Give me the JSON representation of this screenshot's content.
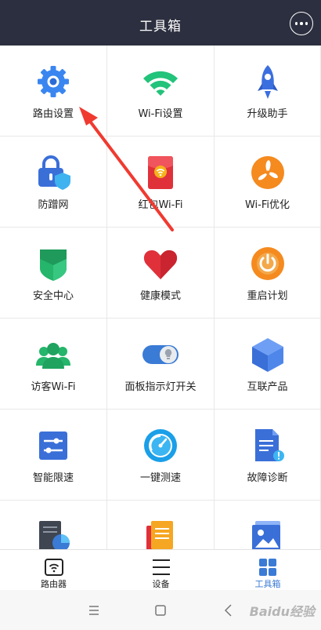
{
  "header": {
    "title": "工具箱"
  },
  "tools": [
    {
      "label": "路由设置",
      "icon": "gear-icon"
    },
    {
      "label": "Wi-Fi设置",
      "icon": "wifi-icon"
    },
    {
      "label": "升级助手",
      "icon": "rocket-icon"
    },
    {
      "label": "防蹭网",
      "icon": "lock-shield-icon"
    },
    {
      "label": "红包Wi-Fi",
      "icon": "red-envelope-icon"
    },
    {
      "label": "Wi-Fi优化",
      "icon": "fan-icon"
    },
    {
      "label": "安全中心",
      "icon": "shield-icon"
    },
    {
      "label": "健康模式",
      "icon": "heart-icon"
    },
    {
      "label": "重启计划",
      "icon": "power-icon"
    },
    {
      "label": "访客Wi-Fi",
      "icon": "guests-icon"
    },
    {
      "label": "面板指示灯开关",
      "icon": "toggle-bulb-icon"
    },
    {
      "label": "互联产品",
      "icon": "cube-icon"
    },
    {
      "label": "智能限速",
      "icon": "sliders-icon"
    },
    {
      "label": "一键测速",
      "icon": "speedometer-icon"
    },
    {
      "label": "故障诊断",
      "icon": "document-alert-icon"
    },
    {
      "label": "",
      "icon": "report-chart-icon"
    },
    {
      "label": "",
      "icon": "notes-icon"
    },
    {
      "label": "",
      "icon": "image-icon"
    }
  ],
  "tabbar": {
    "router": "路由器",
    "devices": "设备",
    "toolbox": "工具箱"
  },
  "watermark": "Baidu经验",
  "colors": {
    "header_bg": "#2c2f3f",
    "accent": "#3a7bd5",
    "annotation_arrow": "#f03a30"
  }
}
